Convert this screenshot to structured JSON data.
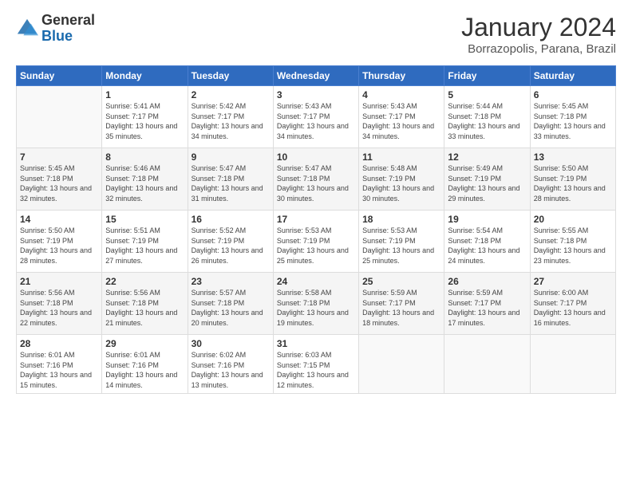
{
  "header": {
    "logo_general": "General",
    "logo_blue": "Blue",
    "month_title": "January 2024",
    "subtitle": "Borrazopolis, Parana, Brazil"
  },
  "weekdays": [
    "Sunday",
    "Monday",
    "Tuesday",
    "Wednesday",
    "Thursday",
    "Friday",
    "Saturday"
  ],
  "weeks": [
    [
      {
        "num": "",
        "sunrise": "",
        "sunset": "",
        "daylight": ""
      },
      {
        "num": "1",
        "sunrise": "Sunrise: 5:41 AM",
        "sunset": "Sunset: 7:17 PM",
        "daylight": "Daylight: 13 hours and 35 minutes."
      },
      {
        "num": "2",
        "sunrise": "Sunrise: 5:42 AM",
        "sunset": "Sunset: 7:17 PM",
        "daylight": "Daylight: 13 hours and 34 minutes."
      },
      {
        "num": "3",
        "sunrise": "Sunrise: 5:43 AM",
        "sunset": "Sunset: 7:17 PM",
        "daylight": "Daylight: 13 hours and 34 minutes."
      },
      {
        "num": "4",
        "sunrise": "Sunrise: 5:43 AM",
        "sunset": "Sunset: 7:17 PM",
        "daylight": "Daylight: 13 hours and 34 minutes."
      },
      {
        "num": "5",
        "sunrise": "Sunrise: 5:44 AM",
        "sunset": "Sunset: 7:18 PM",
        "daylight": "Daylight: 13 hours and 33 minutes."
      },
      {
        "num": "6",
        "sunrise": "Sunrise: 5:45 AM",
        "sunset": "Sunset: 7:18 PM",
        "daylight": "Daylight: 13 hours and 33 minutes."
      }
    ],
    [
      {
        "num": "7",
        "sunrise": "Sunrise: 5:45 AM",
        "sunset": "Sunset: 7:18 PM",
        "daylight": "Daylight: 13 hours and 32 minutes."
      },
      {
        "num": "8",
        "sunrise": "Sunrise: 5:46 AM",
        "sunset": "Sunset: 7:18 PM",
        "daylight": "Daylight: 13 hours and 32 minutes."
      },
      {
        "num": "9",
        "sunrise": "Sunrise: 5:47 AM",
        "sunset": "Sunset: 7:18 PM",
        "daylight": "Daylight: 13 hours and 31 minutes."
      },
      {
        "num": "10",
        "sunrise": "Sunrise: 5:47 AM",
        "sunset": "Sunset: 7:18 PM",
        "daylight": "Daylight: 13 hours and 30 minutes."
      },
      {
        "num": "11",
        "sunrise": "Sunrise: 5:48 AM",
        "sunset": "Sunset: 7:19 PM",
        "daylight": "Daylight: 13 hours and 30 minutes."
      },
      {
        "num": "12",
        "sunrise": "Sunrise: 5:49 AM",
        "sunset": "Sunset: 7:19 PM",
        "daylight": "Daylight: 13 hours and 29 minutes."
      },
      {
        "num": "13",
        "sunrise": "Sunrise: 5:50 AM",
        "sunset": "Sunset: 7:19 PM",
        "daylight": "Daylight: 13 hours and 28 minutes."
      }
    ],
    [
      {
        "num": "14",
        "sunrise": "Sunrise: 5:50 AM",
        "sunset": "Sunset: 7:19 PM",
        "daylight": "Daylight: 13 hours and 28 minutes."
      },
      {
        "num": "15",
        "sunrise": "Sunrise: 5:51 AM",
        "sunset": "Sunset: 7:19 PM",
        "daylight": "Daylight: 13 hours and 27 minutes."
      },
      {
        "num": "16",
        "sunrise": "Sunrise: 5:52 AM",
        "sunset": "Sunset: 7:19 PM",
        "daylight": "Daylight: 13 hours and 26 minutes."
      },
      {
        "num": "17",
        "sunrise": "Sunrise: 5:53 AM",
        "sunset": "Sunset: 7:19 PM",
        "daylight": "Daylight: 13 hours and 25 minutes."
      },
      {
        "num": "18",
        "sunrise": "Sunrise: 5:53 AM",
        "sunset": "Sunset: 7:19 PM",
        "daylight": "Daylight: 13 hours and 25 minutes."
      },
      {
        "num": "19",
        "sunrise": "Sunrise: 5:54 AM",
        "sunset": "Sunset: 7:18 PM",
        "daylight": "Daylight: 13 hours and 24 minutes."
      },
      {
        "num": "20",
        "sunrise": "Sunrise: 5:55 AM",
        "sunset": "Sunset: 7:18 PM",
        "daylight": "Daylight: 13 hours and 23 minutes."
      }
    ],
    [
      {
        "num": "21",
        "sunrise": "Sunrise: 5:56 AM",
        "sunset": "Sunset: 7:18 PM",
        "daylight": "Daylight: 13 hours and 22 minutes."
      },
      {
        "num": "22",
        "sunrise": "Sunrise: 5:56 AM",
        "sunset": "Sunset: 7:18 PM",
        "daylight": "Daylight: 13 hours and 21 minutes."
      },
      {
        "num": "23",
        "sunrise": "Sunrise: 5:57 AM",
        "sunset": "Sunset: 7:18 PM",
        "daylight": "Daylight: 13 hours and 20 minutes."
      },
      {
        "num": "24",
        "sunrise": "Sunrise: 5:58 AM",
        "sunset": "Sunset: 7:18 PM",
        "daylight": "Daylight: 13 hours and 19 minutes."
      },
      {
        "num": "25",
        "sunrise": "Sunrise: 5:59 AM",
        "sunset": "Sunset: 7:17 PM",
        "daylight": "Daylight: 13 hours and 18 minutes."
      },
      {
        "num": "26",
        "sunrise": "Sunrise: 5:59 AM",
        "sunset": "Sunset: 7:17 PM",
        "daylight": "Daylight: 13 hours and 17 minutes."
      },
      {
        "num": "27",
        "sunrise": "Sunrise: 6:00 AM",
        "sunset": "Sunset: 7:17 PM",
        "daylight": "Daylight: 13 hours and 16 minutes."
      }
    ],
    [
      {
        "num": "28",
        "sunrise": "Sunrise: 6:01 AM",
        "sunset": "Sunset: 7:16 PM",
        "daylight": "Daylight: 13 hours and 15 minutes."
      },
      {
        "num": "29",
        "sunrise": "Sunrise: 6:01 AM",
        "sunset": "Sunset: 7:16 PM",
        "daylight": "Daylight: 13 hours and 14 minutes."
      },
      {
        "num": "30",
        "sunrise": "Sunrise: 6:02 AM",
        "sunset": "Sunset: 7:16 PM",
        "daylight": "Daylight: 13 hours and 13 minutes."
      },
      {
        "num": "31",
        "sunrise": "Sunrise: 6:03 AM",
        "sunset": "Sunset: 7:15 PM",
        "daylight": "Daylight: 13 hours and 12 minutes."
      },
      {
        "num": "",
        "sunrise": "",
        "sunset": "",
        "daylight": ""
      },
      {
        "num": "",
        "sunrise": "",
        "sunset": "",
        "daylight": ""
      },
      {
        "num": "",
        "sunrise": "",
        "sunset": "",
        "daylight": ""
      }
    ]
  ]
}
